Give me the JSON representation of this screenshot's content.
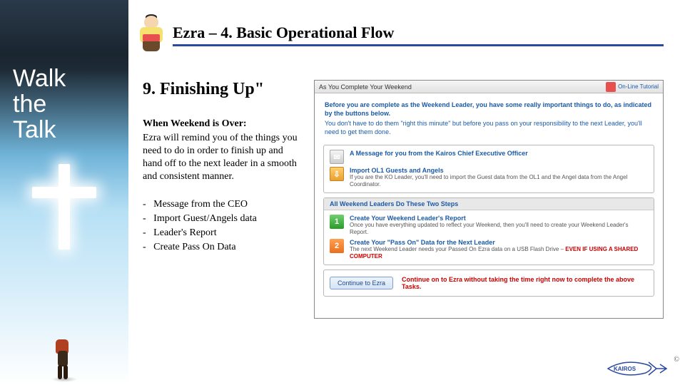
{
  "rail": {
    "title_line1": "Walk",
    "title_line2": "the",
    "title_line3": "Talk"
  },
  "header": {
    "title": "Ezra – 4. Basic Operational Flow"
  },
  "section": {
    "heading": "9. Finishing Up\"",
    "lead_bold": "When Weekend is Over:",
    "lead_body": "Ezra will remind you of the things you need to do in order to finish up and hand off to the next leader in a smooth and consistent manner.",
    "bullets": [
      "Message from the CEO",
      "Import Guest/Angels data",
      "Leader's Report",
      "Create Pass On Data"
    ]
  },
  "screenshot": {
    "window_title": "As You Complete Your Weekend",
    "top_link": "On-Line Tutorial",
    "intro_line1": "Before you are complete as the Weekend Leader, you have some really important things to do, as indicated by the buttons below.",
    "intro_line2": "You don't have to do them \"right this minute\" but before you pass on your responsibility to the next Leader, you'll need to get them done.",
    "box1": {
      "row1_title": "A Message for you from the Kairos Chief Executive Officer",
      "row2_title": "Import OL1 Guests and Angels",
      "row2_sub": "If you are the KO Leader, you'll need to import the Guest data from the OL1 and the Angel data from the Angel Coordinator."
    },
    "box2": {
      "header": "All Weekend Leaders Do These Two Steps",
      "row1_title": "Create Your Weekend Leader's Report",
      "row1_sub": "Once you have everything updated to reflect your Weekend, then you'll need to create your Weekend Leader's Report.",
      "row2_title": "Create Your \"Pass On\" Data for the Next Leader",
      "row2_sub_a": "The next Weekend Leader needs your Passed On Ezra data on a USB Flash Drive – ",
      "row2_sub_b": "EVEN IF USING A SHARED COMPUTER"
    },
    "footer": {
      "button": "Continue to Ezra",
      "message": "Continue on to Ezra without taking the time right now to complete the above Tasks."
    }
  },
  "footer": {
    "logo_text": "KAIROS",
    "copyright": "©"
  }
}
